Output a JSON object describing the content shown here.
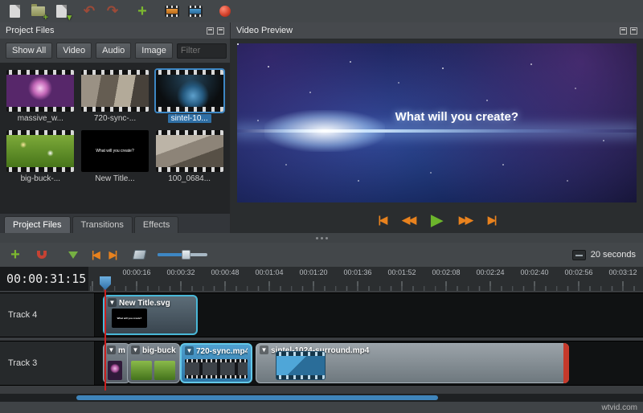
{
  "toolbar": {
    "icons": [
      "new-project",
      "open-project",
      "save-project",
      "undo",
      "redo",
      "import-files",
      "choose-profile",
      "animated-title",
      "export-video"
    ]
  },
  "project_files": {
    "title": "Project Files",
    "filter_buttons": [
      {
        "label": "Show All"
      },
      {
        "label": "Video"
      },
      {
        "label": "Audio"
      },
      {
        "label": "Image"
      }
    ],
    "filter_placeholder": "Filter",
    "items": [
      {
        "label": "massive_w...",
        "selected": false
      },
      {
        "label": "720-sync-...",
        "selected": false
      },
      {
        "label": "sintel-10...",
        "selected": true
      },
      {
        "label": "big-buck-...",
        "selected": false
      },
      {
        "label": "New Title...",
        "selected": false
      },
      {
        "label": "100_0684...",
        "selected": false
      }
    ],
    "tabs": [
      {
        "label": "Project Files",
        "active": true
      },
      {
        "label": "Transitions",
        "active": false
      },
      {
        "label": "Effects",
        "active": false
      }
    ]
  },
  "video_preview": {
    "title": "Video Preview",
    "overlay_text": "What will you create?",
    "playback": [
      {
        "name": "jump-start",
        "glyph": "|◀"
      },
      {
        "name": "rewind",
        "glyph": "◀◀"
      },
      {
        "name": "play",
        "glyph": "▶"
      },
      {
        "name": "fast-forward",
        "glyph": "▶▶"
      },
      {
        "name": "jump-end",
        "glyph": "▶|"
      }
    ]
  },
  "timeline": {
    "timecode": "00:00:31:15",
    "zoom_label": "20 seconds",
    "ruler_labels": [
      "00:00:16",
      "00:00:32",
      "00:00:48",
      "00:01:04",
      "00:01:20",
      "00:01:36",
      "00:01:52",
      "00:02:08",
      "00:02:24",
      "00:02:40",
      "00:02:56",
      "00:03:12"
    ],
    "tracks": [
      {
        "name": "Track 4",
        "clips": [
          {
            "label": "New Title.svg"
          }
        ]
      },
      {
        "name": "Track 3",
        "clips": [
          {
            "label": "m"
          },
          {
            "label": "big-buck-"
          },
          {
            "label": "720-sync.mp4"
          },
          {
            "label": "sintel-1024-surround.mp4"
          }
        ]
      }
    ],
    "colors": {
      "accent_blue": "#3d87c4",
      "selected_clip": "#49b8d8",
      "playhead_red": "#cc1f1f",
      "orange": "#e8821e",
      "green": "#76b043"
    }
  },
  "watermark": "wtvid.com"
}
